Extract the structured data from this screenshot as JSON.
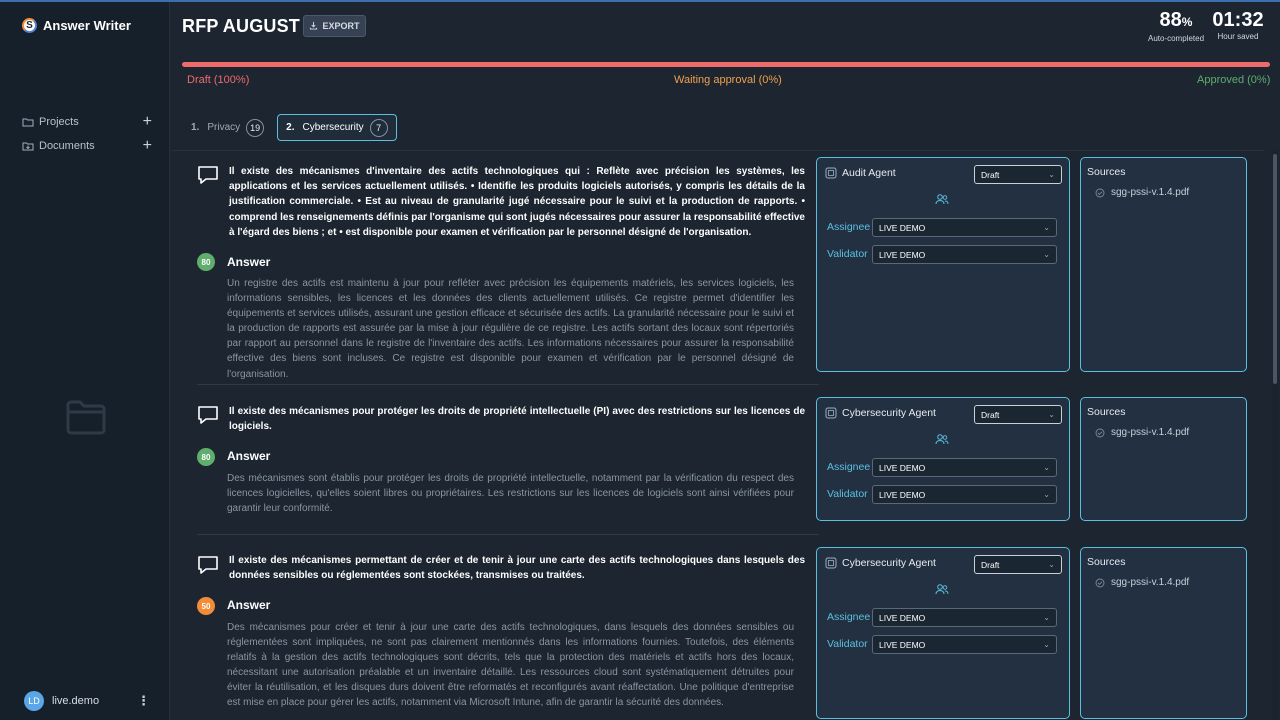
{
  "app": {
    "name": "Answer Writer",
    "logo_letter": "S"
  },
  "sidebar": {
    "items": [
      {
        "label": "Projects",
        "action": "+"
      },
      {
        "label": "Documents",
        "action": "+"
      }
    ],
    "user": {
      "initials": "LD",
      "name": "live.demo"
    }
  },
  "header": {
    "title": "RFP AUGUST",
    "export_label": "EXPORT",
    "stats": [
      {
        "value": "88",
        "unit": "%",
        "label": "Auto-completed"
      },
      {
        "value": "01:32",
        "label": "Hour saved"
      }
    ]
  },
  "progress": {
    "draft_fraction": 1.0,
    "draft_label": "Draft (100%)",
    "waiting_label": "Waiting approval (0%)",
    "approved_label": "Approved (0%)",
    "colors": {
      "draft": "#ef6b6b",
      "waiting": "#f0a04b",
      "approved": "#5fae6e"
    }
  },
  "tabs": [
    {
      "number": "1.",
      "label": "Privacy",
      "count": "19",
      "active": false
    },
    {
      "number": "2.",
      "label": "Cybersecurity",
      "count": "7",
      "active": true
    }
  ],
  "items": [
    {
      "question": "Il existe des mécanismes d'inventaire des actifs technologiques qui : Reflète avec précision les systèmes, les applications et les services actuellement utilisés. • Identifie les produits logiciels autorisés, y compris les détails de la justification commerciale. • Est au niveau de granularité jugé nécessaire pour le suivi et la production de rapports. • comprend les renseignements définis par l'organisme qui sont jugés nécessaires pour assurer la responsabilité effective à l'égard des biens ; et • est disponible pour examen et vérification par le personnel désigné de l'organisation.",
      "score": "80",
      "score_color": "#5fae6e",
      "answer_label": "Answer",
      "answer": "Un registre des actifs est maintenu à jour pour refléter avec précision les équipements matériels, les services logiciels, les informations sensibles, les licences et les données des clients actuellement utilisés. Ce registre permet d'identifier les équipements et services utilisés, assurant une gestion efficace et sécurisée des actifs. La granularité nécessaire pour le suivi et la production de rapports est assurée par la mise à jour régulière de ce registre. Les actifs sortant des locaux sont répertoriés par rapport au personnel dans le registre de l'inventaire des actifs. Les informations nécessaires pour assurer la responsabilité effective des biens sont incluses. Ce registre est disponible pour examen et vérification par le personnel désigné de l'organisation.",
      "agent": "Audit Agent",
      "status": "Draft",
      "assignee_label": "Assignee",
      "assignee": "LIVE DEMO",
      "validator_label": "Validator",
      "validator": "LIVE DEMO",
      "sources_title": "Sources",
      "sources": [
        "sgg-pssi-v.1.4.pdf"
      ]
    },
    {
      "question": "Il existe des mécanismes pour protéger les droits de propriété intellectuelle (PI) avec des restrictions sur les licences de logiciels.",
      "score": "80",
      "score_color": "#5fae6e",
      "answer_label": "Answer",
      "answer": "Des mécanismes sont établis pour protéger les droits de propriété intellectuelle, notamment par la vérification du respect des licences logicielles, qu'elles soient libres ou propriétaires. Les restrictions sur les licences de logiciels sont ainsi vérifiées pour garantir leur conformité.",
      "agent": "Cybersecurity Agent",
      "status": "Draft",
      "assignee_label": "Assignee",
      "assignee": "LIVE DEMO",
      "validator_label": "Validator",
      "validator": "LIVE DEMO",
      "sources_title": "Sources",
      "sources": [
        "sgg-pssi-v.1.4.pdf"
      ]
    },
    {
      "question": "Il existe des mécanismes permettant de créer et de tenir à jour une carte des actifs technologiques dans lesquels des données sensibles ou réglementées sont stockées, transmises ou traitées.",
      "score": "50",
      "score_color": "#f28c38",
      "answer_label": "Answer",
      "answer": "Des mécanismes pour créer et tenir à jour une carte des actifs technologiques, dans lesquels des données sensibles ou réglementées sont impliquées, ne sont pas clairement mentionnés dans les informations fournies. Toutefois, des éléments relatifs à la gestion des actifs technologiques sont décrits, tels que la protection des matériels et actifs hors des locaux, nécessitant une autorisation préalable et un inventaire détaillé. Les ressources cloud sont systématiquement détruites pour éviter la réutilisation, et les disques durs doivent être reformatés et reconfigurés avant réaffectation. Une politique d'entreprise est mise en place pour gérer les actifs, notamment via Microsoft Intune, afin de garantir la sécurité des données.",
      "agent": "Cybersecurity Agent",
      "status": "Draft",
      "assignee_label": "Assignee",
      "assignee": "LIVE DEMO",
      "validator_label": "Validator",
      "validator": "LIVE DEMO",
      "sources_title": "Sources",
      "sources": [
        "sgg-pssi-v.1.4.pdf"
      ]
    }
  ]
}
